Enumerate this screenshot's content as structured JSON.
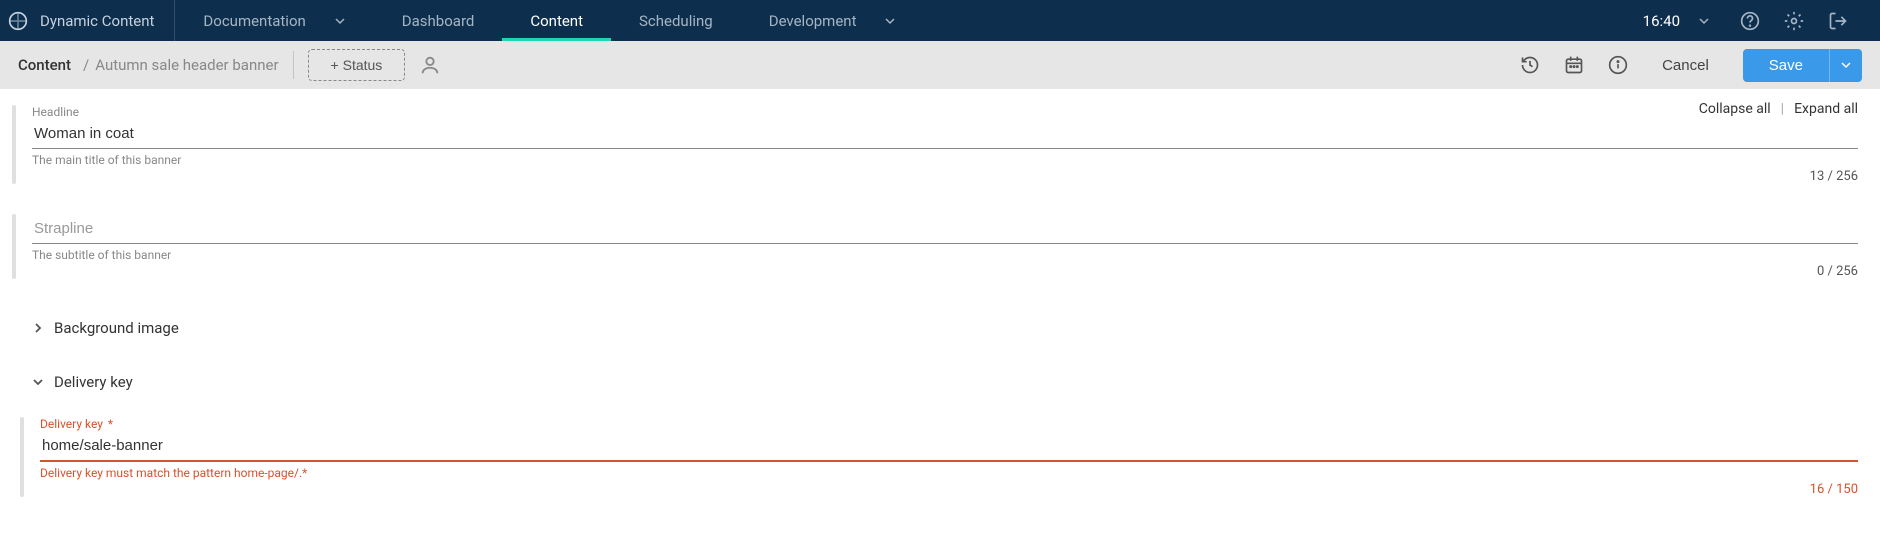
{
  "brand": {
    "name": "Dynamic Content"
  },
  "nav": {
    "documentation": "Documentation",
    "dashboard": "Dashboard",
    "content": "Content",
    "scheduling": "Scheduling",
    "development": "Development",
    "time": "16:40"
  },
  "toolbar": {
    "breadcrumb_root": "Content",
    "breadcrumb_sep": "/",
    "breadcrumb_title": "Autumn sale header banner",
    "status_button": "+ Status",
    "cancel": "Cancel",
    "save": "Save"
  },
  "actions": {
    "collapse_all": "Collapse all",
    "sep": "|",
    "expand_all": "Expand all"
  },
  "fields": {
    "headline": {
      "label": "Headline",
      "value": "Woman in coat",
      "help": "The main title of this banner",
      "count": "13 / 256"
    },
    "strapline": {
      "label": "Strapline",
      "placeholder": "Strapline",
      "value": "",
      "help": "The subtitle of this banner",
      "count": "0 / 256"
    },
    "background_image": {
      "label": "Background image"
    },
    "delivery_key_section": {
      "label": "Delivery key"
    },
    "delivery_key_field": {
      "label": "Delivery key",
      "required": "*",
      "value": "home/sale-banner",
      "error": "Delivery key must match the pattern home-page/.*",
      "count": "16 / 150"
    }
  }
}
